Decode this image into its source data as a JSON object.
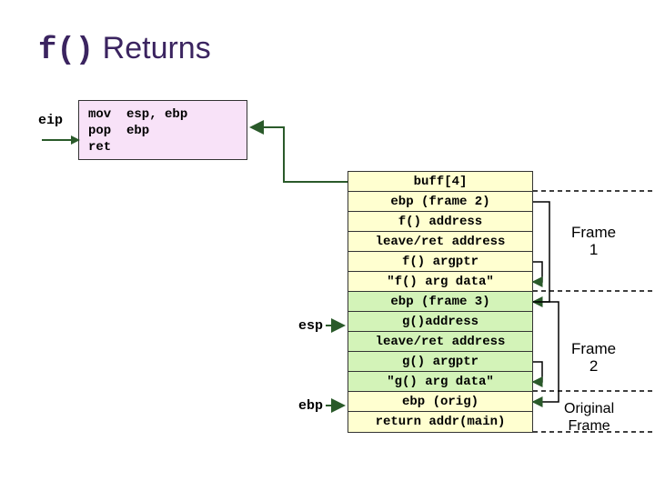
{
  "title": {
    "mono": "f()",
    "rest": " Returns"
  },
  "code": {
    "line1": "mov  esp, ebp",
    "line2": "pop  ebp",
    "line3": "ret"
  },
  "eip_label": "eip",
  "pointers": {
    "esp": "esp",
    "ebp": "ebp"
  },
  "stack": [
    {
      "text": "buff[4]",
      "cls": "buff"
    },
    {
      "text": "ebp (frame 2)",
      "cls": "yellow"
    },
    {
      "text": "f() address",
      "cls": "yellow"
    },
    {
      "text": "leave/ret address",
      "cls": "yellow"
    },
    {
      "text": "f() argptr",
      "cls": "yellow"
    },
    {
      "text": "\"f() arg data\"",
      "cls": "yellow"
    },
    {
      "text": "ebp (frame 3)",
      "cls": "green"
    },
    {
      "text": "g()address",
      "cls": "green"
    },
    {
      "text": "leave/ret address",
      "cls": "green"
    },
    {
      "text": "g() argptr",
      "cls": "green"
    },
    {
      "text": "\"g() arg data\"",
      "cls": "green"
    },
    {
      "text": "ebp (orig)",
      "cls": "yellow"
    },
    {
      "text": "return addr(main)",
      "cls": "yellow"
    }
  ],
  "frame_labels": {
    "f1": "Frame\n1",
    "f2": "Frame\n2",
    "orig": "Original\nFrame"
  }
}
